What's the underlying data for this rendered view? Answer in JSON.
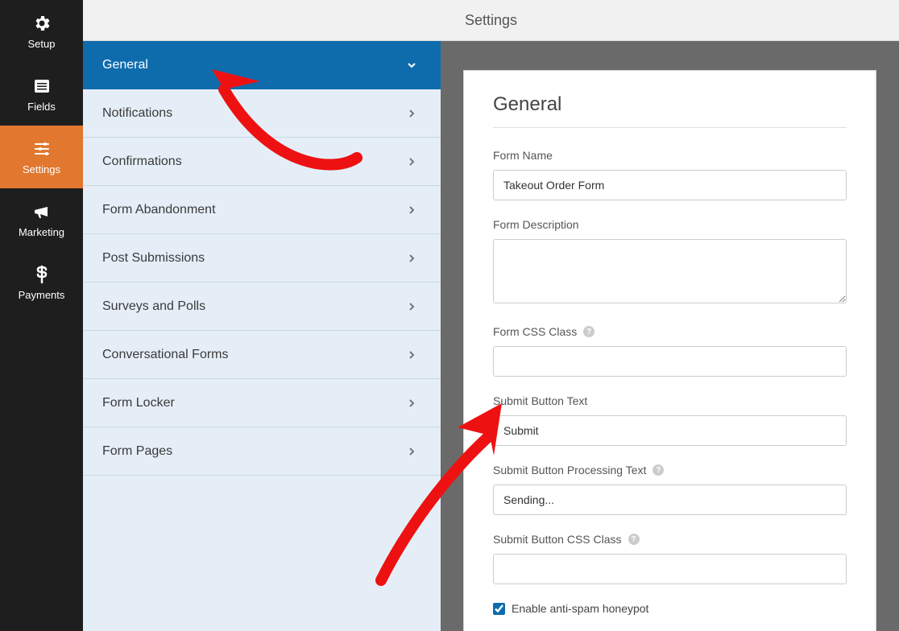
{
  "topbar": {
    "title": "Settings"
  },
  "leftnav": {
    "items": [
      {
        "label": "Setup",
        "icon": "gear"
      },
      {
        "label": "Fields",
        "icon": "list"
      },
      {
        "label": "Settings",
        "icon": "sliders",
        "active": true
      },
      {
        "label": "Marketing",
        "icon": "bullhorn"
      },
      {
        "label": "Payments",
        "icon": "dollar"
      }
    ]
  },
  "settings_menu": {
    "items": [
      {
        "label": "General",
        "expanded": true
      },
      {
        "label": "Notifications"
      },
      {
        "label": "Confirmations"
      },
      {
        "label": "Form Abandonment"
      },
      {
        "label": "Post Submissions"
      },
      {
        "label": "Surveys and Polls"
      },
      {
        "label": "Conversational Forms"
      },
      {
        "label": "Form Locker"
      },
      {
        "label": "Form Pages"
      }
    ]
  },
  "general_panel": {
    "heading": "General",
    "form_name": {
      "label": "Form Name",
      "value": "Takeout Order Form"
    },
    "form_description": {
      "label": "Form Description",
      "value": ""
    },
    "form_css_class": {
      "label": "Form CSS Class",
      "value": ""
    },
    "submit_text": {
      "label": "Submit Button Text",
      "value": "Submit"
    },
    "submit_processing": {
      "label": "Submit Button Processing Text",
      "value": "Sending..."
    },
    "submit_css_class": {
      "label": "Submit Button CSS Class",
      "value": ""
    },
    "antispam": {
      "label": "Enable anti-spam honeypot",
      "checked": true
    }
  }
}
